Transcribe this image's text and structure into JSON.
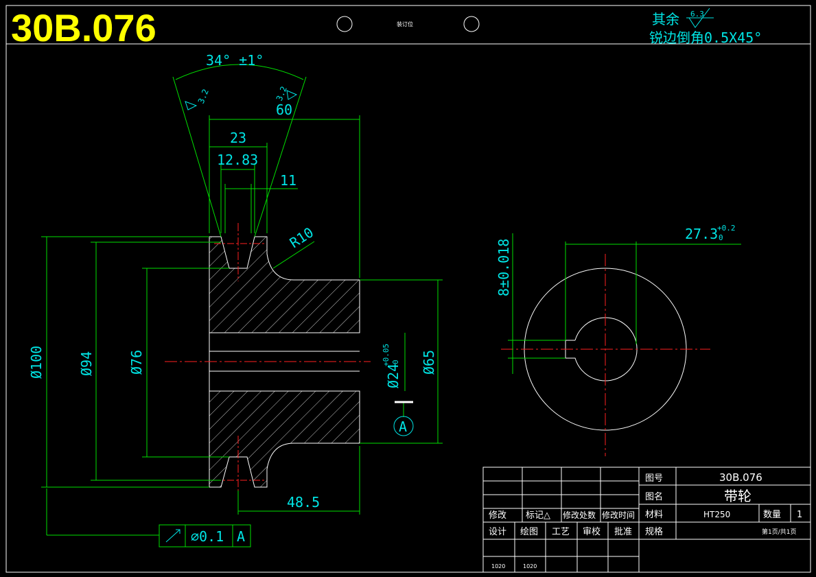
{
  "drawing": {
    "number_big": "30B.076",
    "binding_label": "装订位",
    "roughness_note": "其余",
    "roughness_value": "6.3",
    "chamfer_note": "锐边倒角0.5X45°"
  },
  "dimensions": {
    "angle": "34° ±1°",
    "rough_left": "3.2",
    "rough_right": "3.2",
    "width_60": "60",
    "width_23": "23",
    "width_1283": "12.83",
    "width_11": "11",
    "radius": "R10",
    "dia_100": "Ø100",
    "dia_94": "Ø94",
    "dia_76": "Ø76",
    "dia_65": "Ø65",
    "bore": "Ø24",
    "bore_tol_upper": "+0.05",
    "bore_tol_lower": "0",
    "datum": "A",
    "len_485": "48.5",
    "key_width": "8±0.018",
    "key_depth": "27.3",
    "key_tol_upper": "+0.2",
    "key_tol_lower": "0"
  },
  "tolerance_frame": {
    "value": "∅0.1",
    "datum": "A"
  },
  "title_block": {
    "drawing_no_label": "图号",
    "drawing_no": "30B.076",
    "name_label": "图名",
    "name": "带轮",
    "material_label": "材料",
    "material": "HT250",
    "qty_label": "数量",
    "qty": "1",
    "spec_label": "规格",
    "page": "第1页/共1页",
    "rev_labels": [
      "修改",
      "标记△",
      "修改处数",
      "修改时间"
    ],
    "sign_labels": [
      "设计",
      "绘图",
      "工艺",
      "审校",
      "批准"
    ],
    "dates": [
      "1020",
      "1020"
    ]
  }
}
